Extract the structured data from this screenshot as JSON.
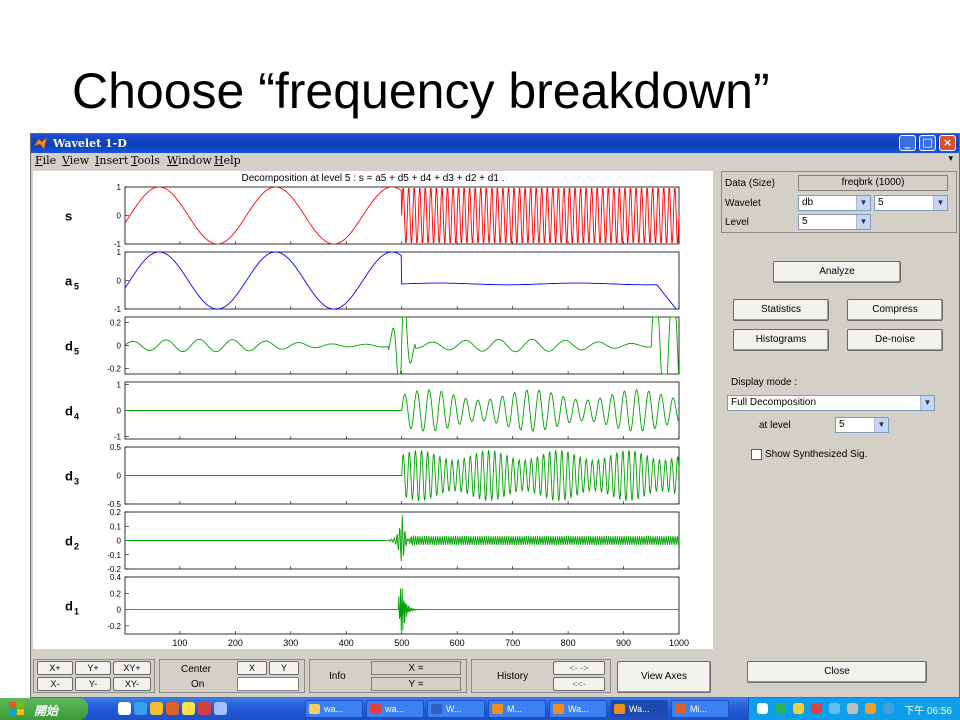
{
  "slide": {
    "title": "Choose “frequency breakdown”"
  },
  "window": {
    "title": "Wavelet 1-D",
    "controls": {
      "minimize": "_",
      "maximize": "□",
      "close": "×"
    },
    "menu": [
      "File",
      "View",
      "Insert",
      "Tools",
      "Window",
      "Help"
    ],
    "menu_arrow": "▾"
  },
  "plot": {
    "heading": "Decomposition at level 5 : s = a5 + d5 + d4 + d3 + d2 + d1 ."
  },
  "chart_data": {
    "type": "line",
    "xlim": [
      1,
      1000
    ],
    "x_ticks": [
      100,
      200,
      300,
      400,
      500,
      600,
      700,
      800,
      900,
      1000
    ],
    "change_point": 500,
    "panels": [
      {
        "label": "s",
        "sub": "",
        "color": "#ff0000",
        "ylim": [
          -1,
          1
        ],
        "ticks": [
          1,
          0,
          -1
        ],
        "tick_labels": [
          "1",
          "0",
          "-1"
        ],
        "model": "signal",
        "amplitude": 1
      },
      {
        "label": "a",
        "sub": "5",
        "color": "#0000ff",
        "ylim": [
          -1,
          1
        ],
        "ticks": [
          1,
          0,
          -1
        ],
        "tick_labels": [
          "1",
          "0",
          "-1"
        ],
        "model": "approx",
        "amplitude": 1
      },
      {
        "label": "d",
        "sub": "5",
        "color": "#00a000",
        "ylim": [
          -0.25,
          0.25
        ],
        "ticks": [
          0.2,
          0,
          -0.2
        ],
        "tick_labels": [
          "0.2",
          "0",
          "-0.2"
        ],
        "model": "d5",
        "amplitude": 0.22
      },
      {
        "label": "d",
        "sub": "4",
        "color": "#00a000",
        "ylim": [
          -1.1,
          1.1
        ],
        "ticks": [
          1,
          0,
          -1
        ],
        "tick_labels": [
          "1",
          "0",
          "-1"
        ],
        "model": "d4",
        "amplitude": 0.8
      },
      {
        "label": "d",
        "sub": "3",
        "color": "#00a000",
        "ylim": [
          -0.5,
          0.5
        ],
        "ticks": [
          0.5,
          0,
          -0.5
        ],
        "tick_labels": [
          "0.5",
          "0",
          "-0.5"
        ],
        "model": "d3",
        "amplitude": 0.45
      },
      {
        "label": "d",
        "sub": "2",
        "color": "#00a000",
        "ylim": [
          -0.2,
          0.2
        ],
        "ticks": [
          0.2,
          0.1,
          0,
          -0.1,
          -0.2
        ],
        "tick_labels": [
          "0.2",
          "0.1",
          "0",
          "-0.1",
          "-0.2"
        ],
        "model": "d2",
        "amplitude": 0.03
      },
      {
        "label": "d",
        "sub": "1",
        "color": "#00a000",
        "ylim": [
          -0.3,
          0.4
        ],
        "ticks": [
          0.4,
          0.2,
          0,
          -0.2
        ],
        "tick_labels": [
          "0.4",
          "0.2",
          "0",
          "-0.2"
        ],
        "model": "d1",
        "amplitude": 0.38
      }
    ]
  },
  "panel": {
    "data_label": "Data  (Size)",
    "data_value": "freqbrk  (1000)",
    "wavelet_label": "Wavelet",
    "wavelet_family": "db",
    "wavelet_order": "5",
    "level_label": "Level",
    "level_value": "5",
    "analyze": "Analyze",
    "statistics": "Statistics",
    "compress": "Compress",
    "histograms": "Histograms",
    "denoise": "De-noise",
    "display_mode_label": "Display mode :",
    "display_mode_value": "Full Decomposition",
    "at_level_label": "at level",
    "at_level_value": "5",
    "show_synth": "Show Synthesized Sig.",
    "close": "Close"
  },
  "bottom": {
    "xplus": "X+",
    "yplus": "Y+",
    "xyplus": "XY+",
    "xminus": "X-",
    "yminus": "Y-",
    "xyminus": "XY-",
    "center": "Center",
    "on": "On",
    "x": "X",
    "y": "Y",
    "info": "Info",
    "x_eq": "X =",
    "y_eq": "Y =",
    "history": "History",
    "fwd": "<-   ->",
    "back": "<<-",
    "view_axes": "View Axes"
  },
  "taskbar": {
    "start": "開始",
    "tasks": [
      "wa...",
      "wa...",
      "W...",
      "M...",
      "Wa...",
      "Wa...",
      "Mi..."
    ],
    "clock": "下午 06:56"
  }
}
